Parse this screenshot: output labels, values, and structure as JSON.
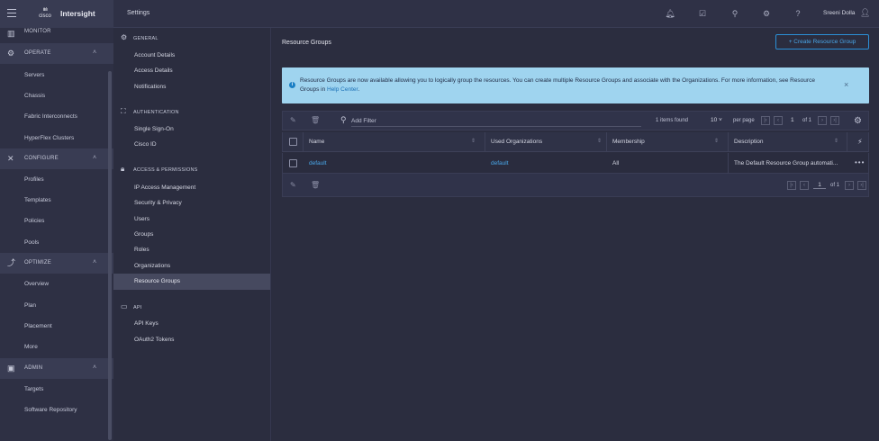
{
  "app": {
    "brand_name": "Intersight",
    "logo_text": "cisco",
    "page_heading": "Settings",
    "user_name": "Sreeni Dolla"
  },
  "leftnav": {
    "sections": [
      {
        "label": "MONITOR",
        "icon": "monitor-icon",
        "items": []
      },
      {
        "label": "OPERATE",
        "icon": "operate-icon",
        "items": [
          "Servers",
          "Chassis",
          "Fabric Interconnects",
          "HyperFlex Clusters"
        ]
      },
      {
        "label": "CONFIGURE",
        "icon": "configure-icon",
        "items": [
          "Profiles",
          "Templates",
          "Policies",
          "Pools"
        ]
      },
      {
        "label": "OPTIMIZE",
        "icon": "optimize-icon",
        "items": [
          "Overview",
          "Plan",
          "Placement",
          "More"
        ]
      },
      {
        "label": "ADMIN",
        "icon": "admin-icon",
        "items": [
          "Targets",
          "Software Repository"
        ]
      }
    ]
  },
  "subnav": {
    "sections": [
      {
        "label": "GENERAL",
        "icon": "settings-icon",
        "items": [
          "Account Details",
          "Access Details",
          "Notifications"
        ]
      },
      {
        "label": "AUTHENTICATION",
        "icon": "authentication-icon",
        "items": [
          "Single Sign-On",
          "Cisco ID"
        ]
      },
      {
        "label": "ACCESS & PERMISSIONS",
        "icon": "lock-icon",
        "items": [
          "IP Access Management",
          "Security & Privacy",
          "Users",
          "Groups",
          "Roles",
          "Organizations",
          "Resource Groups"
        ]
      },
      {
        "label": "API",
        "icon": "api-icon",
        "items": [
          "API Keys",
          "OAuth2 Tokens"
        ]
      }
    ],
    "selected": "Resource Groups"
  },
  "main": {
    "title": "Resource Groups",
    "create_button": "+ Create Resource Group",
    "banner": {
      "text": "Resource Groups are now available allowing you to logically group the resources. You can create multiple Resource Groups and associate with the Organizations. For more information, see Resource Groups in ",
      "link": "Help Center",
      "tail": "."
    },
    "table": {
      "filter_placeholder": "Add Filter",
      "items_found": "1 items found",
      "per_page_value": "10",
      "per_page_label": "per page",
      "page": "1",
      "of_pages": "of 1",
      "columns": [
        "Name",
        "Used Organizations",
        "Membership",
        "Description"
      ],
      "rows": [
        {
          "name": "default",
          "used_organizations": "default",
          "membership": "All",
          "description": "The Default Resource Group automati..."
        }
      ],
      "footer_page": "1",
      "footer_of": "of 1"
    }
  }
}
